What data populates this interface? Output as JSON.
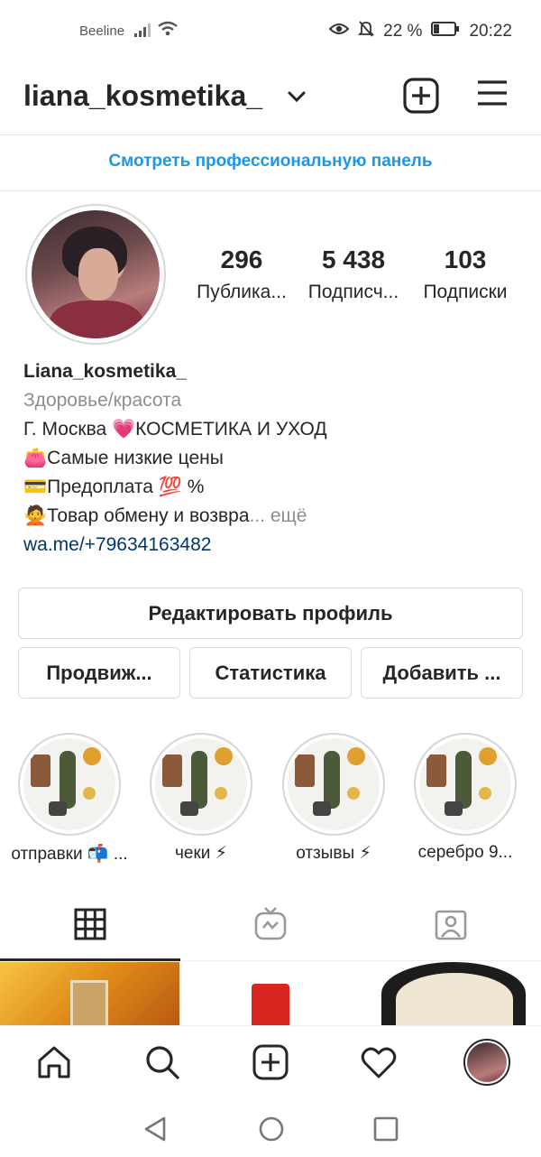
{
  "status_bar": {
    "carrier": "Beeline",
    "battery": "22 %",
    "time": "20:22"
  },
  "header": {
    "username": "liana_kosmetika_"
  },
  "professional_panel_link": "Смотреть профессиональную панель",
  "stats": [
    {
      "number": "296",
      "label": "Публика..."
    },
    {
      "number": "5 438",
      "label": "Подписч..."
    },
    {
      "number": "103",
      "label": "Подписки"
    }
  ],
  "bio": {
    "name": "Liana_kosmetika_",
    "category": "Здоровье/красота",
    "line1": "Г. Москва 💗КОСМЕТИКА И УХОД",
    "line2": "👛Самые низкие цены",
    "line3": "💳Предоплата 💯 %",
    "line4": "🙅Товар обмену и возвра",
    "more": "... ещё",
    "link": "wa.me/+79634163482"
  },
  "buttons": {
    "edit_profile": "Редактировать профиль",
    "promote": "Продвиж...",
    "insights": "Статистика",
    "add": "Добавить ..."
  },
  "highlights": [
    {
      "label": "отправки 📬 ..."
    },
    {
      "label": "чеки ⚡"
    },
    {
      "label": "отзывы ⚡"
    },
    {
      "label": "серебро 9..."
    }
  ],
  "colors": {
    "link_blue": "#1e96e6",
    "text": "#262626",
    "muted": "#8e8e8e",
    "bio_link": "#00376b"
  },
  "icons": {
    "header": [
      "chevron-down-icon",
      "plus-square-icon",
      "hamburger-menu-icon"
    ],
    "tabs": [
      "grid-icon",
      "igtv-icon",
      "tagged-icon"
    ],
    "bottom_nav": [
      "home-icon",
      "search-icon",
      "new-post-icon",
      "heart-icon",
      "profile-avatar"
    ],
    "system_nav": [
      "back-icon",
      "home-circle-icon",
      "recents-icon"
    ]
  }
}
